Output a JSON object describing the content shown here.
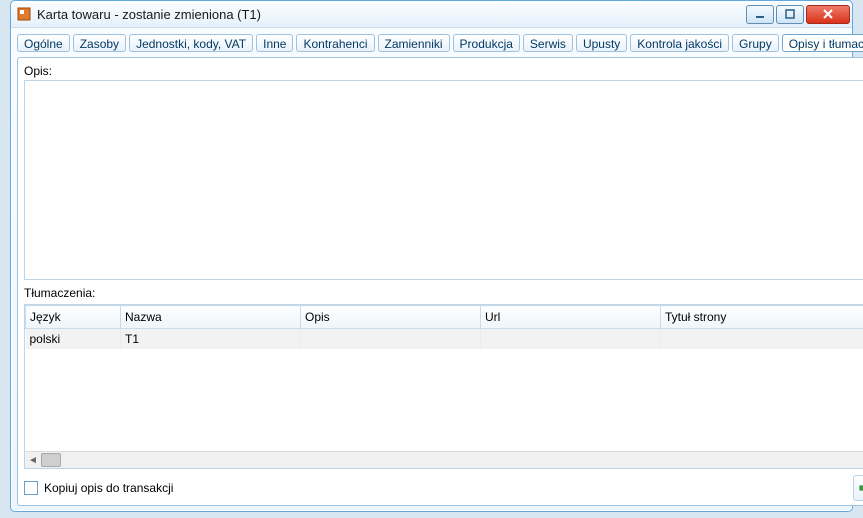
{
  "window": {
    "title": "Karta towaru - zostanie zmieniona (T1)"
  },
  "tabs": [
    "Ogólne",
    "Zasoby",
    "Jednostki, kody, VAT",
    "Inne",
    "Kontrahenci",
    "Zamienniki",
    "Produkcja",
    "Serwis",
    "Upusty",
    "Kontrola jakości",
    "Grupy",
    "Opisy i tłumaczenia"
  ],
  "active_tab_index": 11,
  "opis": {
    "label": "Opis:",
    "value": ""
  },
  "translations": {
    "label": "Tłumaczenia:",
    "columns": [
      "Język",
      "Nazwa",
      "Opis",
      "Url",
      "Tytuł strony"
    ],
    "rows": [
      {
        "jezyk": "polski",
        "nazwa": "T1",
        "opis": "",
        "url": "",
        "tytul": ""
      }
    ]
  },
  "checkbox_label": "Kopiuj opis do transakcji",
  "checkbox_checked": false,
  "icons": {
    "save": "save-icon",
    "delete_red": "delete-x-icon",
    "book": "book-icon",
    "lock": "lock-icon",
    "pin": "pin-icon",
    "add": "plus-icon",
    "zoom": "magnifier-icon",
    "trash": "trash-icon"
  }
}
